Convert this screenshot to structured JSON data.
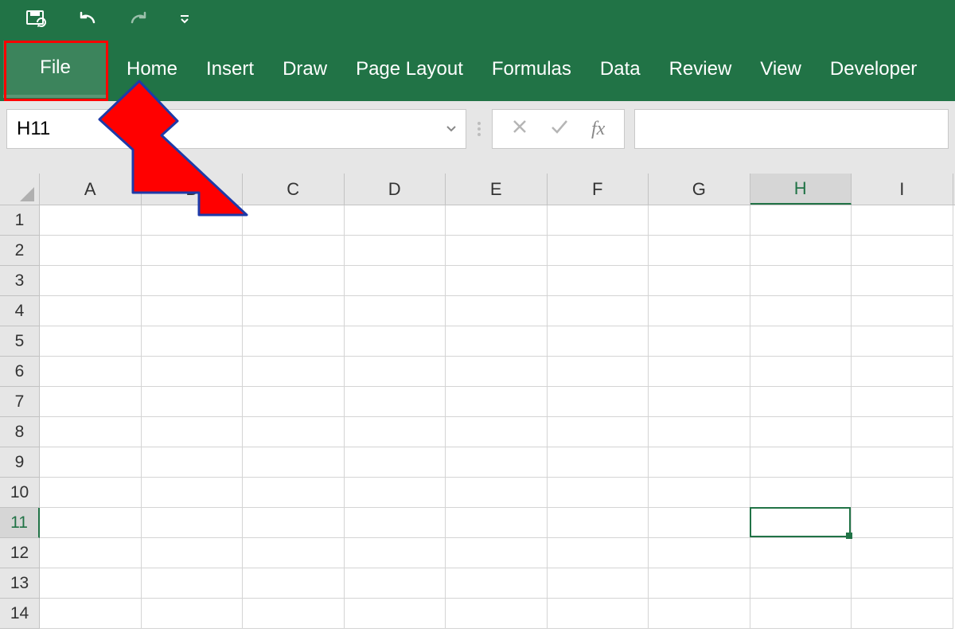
{
  "ribbon": {
    "file": "File",
    "tabs": [
      "Home",
      "Insert",
      "Draw",
      "Page Layout",
      "Formulas",
      "Data",
      "Review",
      "View",
      "Developer"
    ]
  },
  "name_box": "H11",
  "fx_label": "fx",
  "columns": [
    "A",
    "B",
    "C",
    "D",
    "E",
    "F",
    "G",
    "H",
    "I"
  ],
  "rows": [
    "1",
    "2",
    "3",
    "4",
    "5",
    "6",
    "7",
    "8",
    "9",
    "10",
    "11",
    "12",
    "13",
    "14"
  ],
  "selected_cell": "H11",
  "selected_col_index": 7,
  "selected_row_index": 10,
  "colors": {
    "excel_green": "#217346",
    "highlight_red": "#ff0000"
  }
}
